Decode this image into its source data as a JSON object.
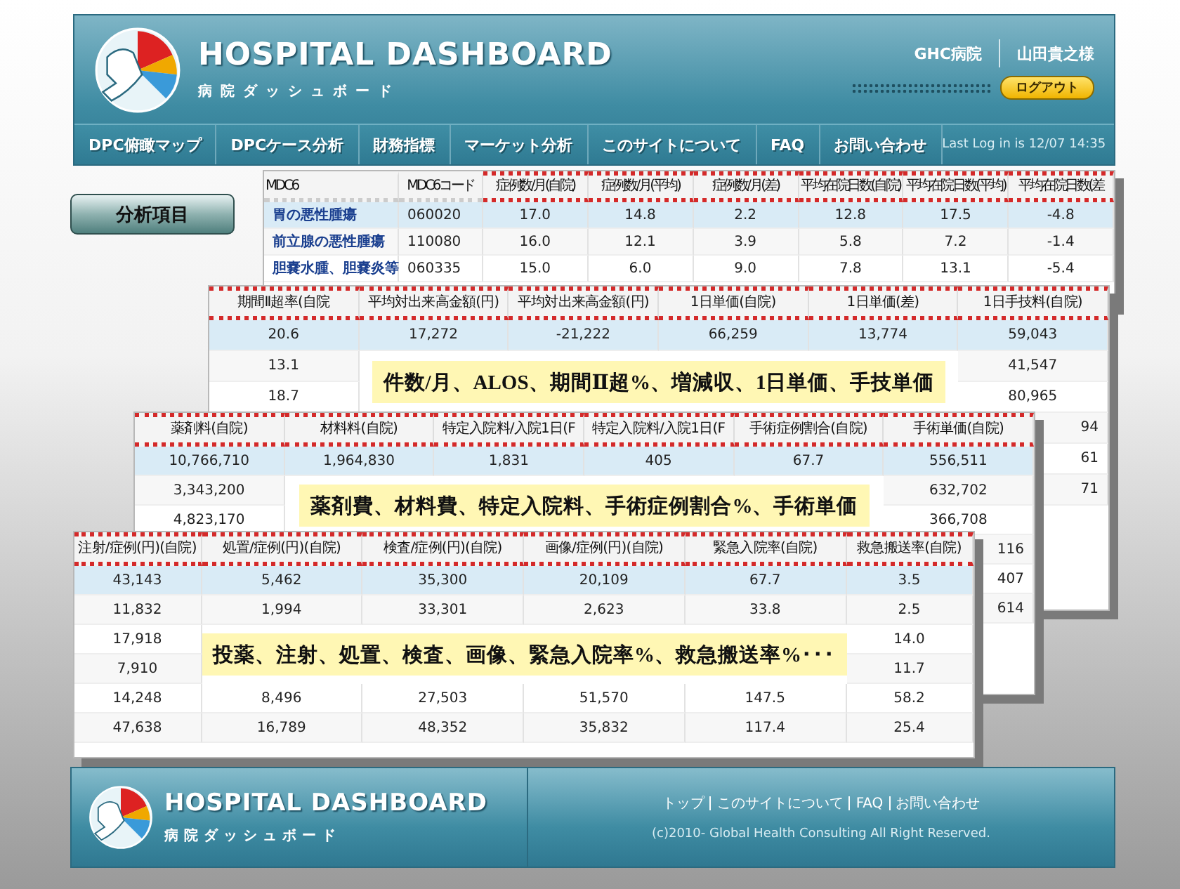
{
  "header": {
    "title": "HOSPITAL DASHBOARD",
    "subtitle": "病院ダッシュボード",
    "hospital": "GHC病院",
    "user": "山田貴之様",
    "logout": "ログアウト"
  },
  "nav": {
    "items": [
      "DPC俯瞰マップ",
      "DPCケース分析",
      "財務指標",
      "マーケット分析",
      "このサイトについて",
      "FAQ",
      "お問い合わせ"
    ],
    "last_login": "Last Log in is 12/07 14:35"
  },
  "side_button": "分析項目",
  "tables": [
    {
      "first_column_links": true,
      "columns": [
        {
          "label": "MDC6",
          "highlighted": false
        },
        {
          "label": "MDC6コード",
          "highlighted": false
        },
        {
          "label": "症例数/月(自院)",
          "highlighted": true
        },
        {
          "label": "症例数/月(平均)",
          "highlighted": true
        },
        {
          "label": "症例数/月(差)",
          "highlighted": true
        },
        {
          "label": "平均在院日数(自院)",
          "highlighted": true
        },
        {
          "label": "平均在院日数(平均)",
          "highlighted": true
        },
        {
          "label": "平均在院日数(差",
          "highlighted": true
        }
      ],
      "rows": [
        {
          "kind": "full",
          "selected": true,
          "cells": [
            "胃の悪性腫瘍",
            "060020",
            "17.0",
            "14.8",
            "2.2",
            "12.8",
            "17.5",
            "-4.8"
          ]
        },
        {
          "kind": "full",
          "selected": false,
          "cells": [
            "前立腺の悪性腫瘍",
            "110080",
            "16.0",
            "12.1",
            "3.9",
            "5.8",
            "7.2",
            "-1.4"
          ]
        },
        {
          "kind": "full",
          "selected": false,
          "cells": [
            "胆嚢水腫、胆嚢炎等",
            "060335",
            "15.0",
            "6.0",
            "9.0",
            "7.8",
            "13.1",
            "-5.4"
          ]
        }
      ]
    },
    {
      "first_column_links": false,
      "callout": "件数/月、ALOS、期間Ⅱ超%、増減収、1日単価、手技単価",
      "columns": [
        {
          "label": "期間Ⅱ超率(自院",
          "highlighted": true
        },
        {
          "label": "平均対出来高金額(円)",
          "highlighted": true
        },
        {
          "label": "平均対出来高金額(円)",
          "highlighted": true
        },
        {
          "label": "1日単価(自院)",
          "highlighted": true
        },
        {
          "label": "1日単価(差)",
          "highlighted": true
        },
        {
          "label": "1日手技料(自院)",
          "highlighted": true
        }
      ],
      "rows": [
        {
          "kind": "full",
          "selected": true,
          "cells": [
            "20.6",
            "17,272",
            "-21,222",
            "66,259",
            "13,774",
            "59,043"
          ]
        },
        {
          "kind": "covered",
          "selected": false,
          "cells": [
            "13.1",
            "41,547"
          ]
        },
        {
          "kind": "covered",
          "selected": false,
          "cells": [
            "18.7",
            "80,965"
          ]
        },
        {
          "kind": "peek",
          "selected": false,
          "cells": [
            "94"
          ]
        },
        {
          "kind": "peek",
          "selected": false,
          "cells": [
            "61"
          ]
        },
        {
          "kind": "peek",
          "selected": false,
          "cells": [
            "71"
          ]
        }
      ]
    },
    {
      "first_column_links": false,
      "callout": "薬剤費、材料費、特定入院料、手術症例割合%、手術単価",
      "columns": [
        {
          "label": "薬剤料(自院)",
          "highlighted": true
        },
        {
          "label": "材料料(自院)",
          "highlighted": true
        },
        {
          "label": "特定入院料/入院1日(F",
          "highlighted": true
        },
        {
          "label": "特定入院料/入院1日(F",
          "highlighted": true
        },
        {
          "label": "手術症例割合(自院)",
          "highlighted": true
        },
        {
          "label": "手術単価(自院)",
          "highlighted": true
        }
      ],
      "rows": [
        {
          "kind": "full",
          "selected": true,
          "cells": [
            "10,766,710",
            "1,964,830",
            "1,831",
            "405",
            "67.7",
            "556,511"
          ]
        },
        {
          "kind": "covered",
          "selected": false,
          "cells": [
            "3,343,200",
            "632,702"
          ]
        },
        {
          "kind": "covered",
          "selected": false,
          "cells": [
            "4,823,170",
            "366,708"
          ]
        },
        {
          "kind": "peek",
          "selected": false,
          "cells": [
            "116"
          ]
        },
        {
          "kind": "peek",
          "selected": false,
          "cells": [
            "407"
          ]
        },
        {
          "kind": "peek",
          "selected": false,
          "cells": [
            "614"
          ]
        }
      ]
    },
    {
      "first_column_links": false,
      "callout": "投薬、注射、処置、検査、画像、緊急入院率%、救急搬送率%･･･",
      "columns": [
        {
          "label": "注射/症例(円)(自院)",
          "highlighted": true
        },
        {
          "label": "処置/症例(円)(自院)",
          "highlighted": true
        },
        {
          "label": "検査/症例(円)(自院)",
          "highlighted": true
        },
        {
          "label": "画像/症例(円)(自院)",
          "highlighted": true
        },
        {
          "label": "緊急入院率(自院)",
          "highlighted": true
        },
        {
          "label": "救急搬送率(自院)",
          "highlighted": true
        }
      ],
      "rows": [
        {
          "kind": "full",
          "selected": true,
          "cells": [
            "43,143",
            "5,462",
            "35,300",
            "20,109",
            "67.7",
            "3.5"
          ]
        },
        {
          "kind": "full",
          "selected": false,
          "cells": [
            "11,832",
            "1,994",
            "33,301",
            "2,623",
            "33.8",
            "2.5"
          ]
        },
        {
          "kind": "covered",
          "selected": false,
          "cells": [
            "17,918",
            "14.0"
          ]
        },
        {
          "kind": "covered",
          "selected": false,
          "cells": [
            "7,910",
            "11.7"
          ]
        },
        {
          "kind": "full",
          "selected": false,
          "cells": [
            "14,248",
            "8,496",
            "27,503",
            "51,570",
            "147.5",
            "58.2"
          ]
        },
        {
          "kind": "full",
          "selected": false,
          "cells": [
            "47,638",
            "16,789",
            "48,352",
            "35,832",
            "117.4",
            "25.4"
          ]
        }
      ]
    }
  ],
  "footer": {
    "title": "HOSPITAL DASHBOARD",
    "subtitle": "病院ダッシュボード",
    "links": [
      "トップ",
      "このサイトについて",
      "FAQ",
      "お問い合わせ"
    ],
    "copyright": "(c)2010- Global Health Consulting All Right Reserved."
  }
}
